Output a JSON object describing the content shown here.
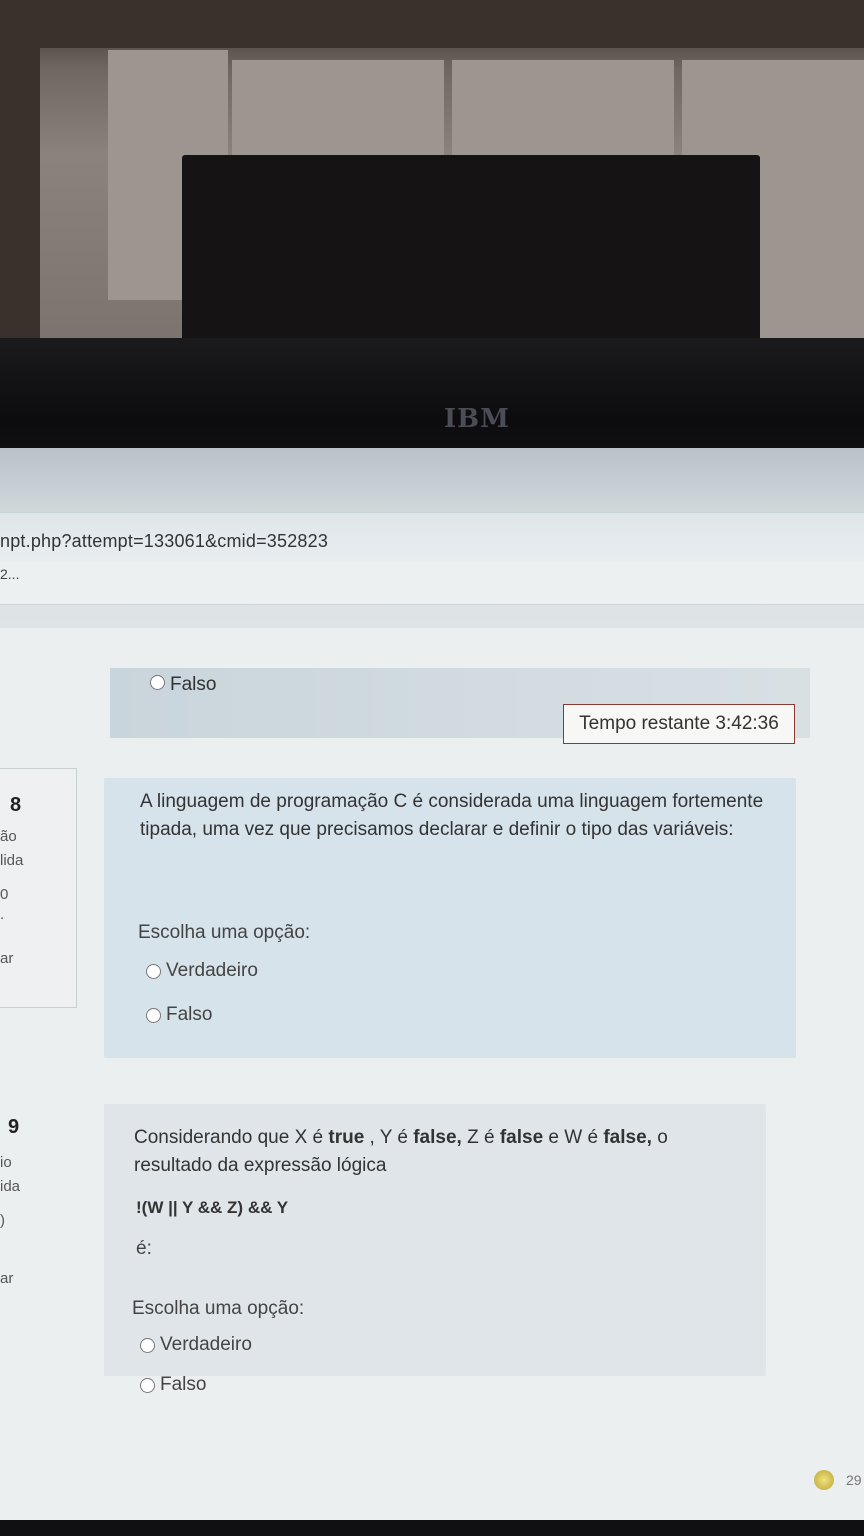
{
  "browser": {
    "url": "npt.php?attempt=133061&cmid=352823",
    "tab_title": "2..."
  },
  "monitor_logo": "IBM",
  "timer": {
    "label": "Tempo restante",
    "value": "3:42:36"
  },
  "previous_question": {
    "option_label": "Falso"
  },
  "questions": [
    {
      "number": "8",
      "meta": [
        "ão",
        "lida",
        "0",
        ".",
        "ar"
      ],
      "text": "A linguagem de programação C é considerada uma linguagem fortemente tipada, uma vez que precisamos declarar e definir o tipo das variáveis:",
      "choose_label": "Escolha uma opção:",
      "options": [
        "Verdadeiro",
        "Falso"
      ]
    },
    {
      "number": "9",
      "meta": [
        "io",
        "ida",
        ")",
        "ar"
      ],
      "text_parts": {
        "p1": "Considerando que X é ",
        "b1": "true",
        "p2": " , Y é ",
        "b2": "false,",
        "p3": " Z é ",
        "b3": "false",
        "p4": " e W é ",
        "b4": "false,",
        "p5": " o resultado da expressão lógica"
      },
      "expression": "!(W || Y &&  Z) && Y",
      "suffix": "é:",
      "choose_label": "Escolha uma opção:",
      "options": [
        "Verdadeiro",
        "Falso"
      ]
    }
  ],
  "page_number": "29"
}
